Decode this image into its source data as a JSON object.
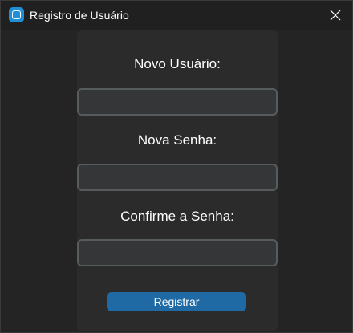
{
  "window": {
    "title": "Registro de Usuário",
    "icon": "app-logo-icon",
    "close_icon": "close-icon"
  },
  "form": {
    "username_label": "Novo Usuário:",
    "username_value": "",
    "password_label": "Nova Senha:",
    "password_value": "",
    "confirm_label": "Confirme a Senha:",
    "confirm_value": "",
    "submit_label": "Registrar"
  },
  "colors": {
    "background": "#242424",
    "panel": "#2b2b2b",
    "field_bg": "#343638",
    "field_border": "#565b5e",
    "button": "#1f6aa5",
    "accent_icon": "#1e8fd8"
  }
}
